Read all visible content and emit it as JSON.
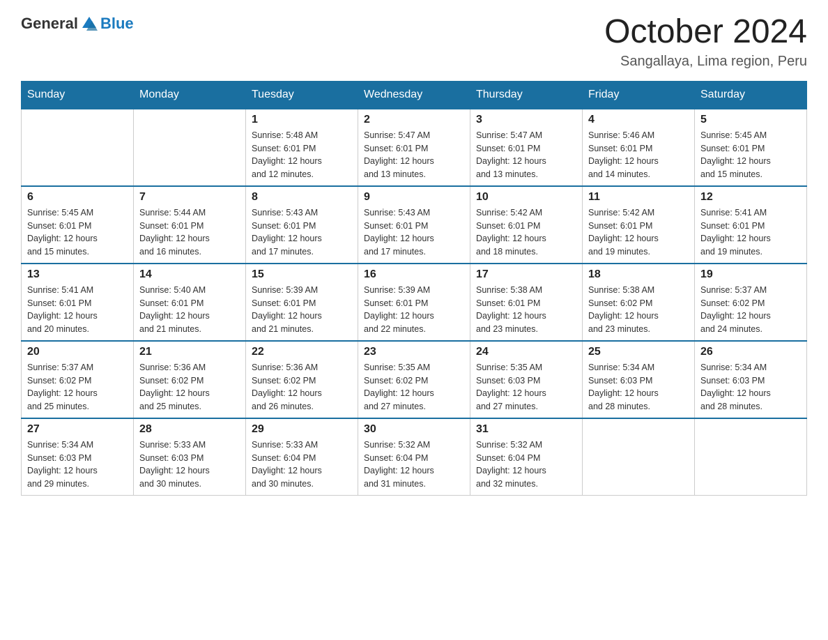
{
  "logo": {
    "general": "General",
    "blue": "Blue"
  },
  "title": "October 2024",
  "subtitle": "Sangallaya, Lima region, Peru",
  "days_of_week": [
    "Sunday",
    "Monday",
    "Tuesday",
    "Wednesday",
    "Thursday",
    "Friday",
    "Saturday"
  ],
  "weeks": [
    [
      {
        "day": "",
        "info": ""
      },
      {
        "day": "",
        "info": ""
      },
      {
        "day": "1",
        "info": "Sunrise: 5:48 AM\nSunset: 6:01 PM\nDaylight: 12 hours\nand 12 minutes."
      },
      {
        "day": "2",
        "info": "Sunrise: 5:47 AM\nSunset: 6:01 PM\nDaylight: 12 hours\nand 13 minutes."
      },
      {
        "day": "3",
        "info": "Sunrise: 5:47 AM\nSunset: 6:01 PM\nDaylight: 12 hours\nand 13 minutes."
      },
      {
        "day": "4",
        "info": "Sunrise: 5:46 AM\nSunset: 6:01 PM\nDaylight: 12 hours\nand 14 minutes."
      },
      {
        "day": "5",
        "info": "Sunrise: 5:45 AM\nSunset: 6:01 PM\nDaylight: 12 hours\nand 15 minutes."
      }
    ],
    [
      {
        "day": "6",
        "info": "Sunrise: 5:45 AM\nSunset: 6:01 PM\nDaylight: 12 hours\nand 15 minutes."
      },
      {
        "day": "7",
        "info": "Sunrise: 5:44 AM\nSunset: 6:01 PM\nDaylight: 12 hours\nand 16 minutes."
      },
      {
        "day": "8",
        "info": "Sunrise: 5:43 AM\nSunset: 6:01 PM\nDaylight: 12 hours\nand 17 minutes."
      },
      {
        "day": "9",
        "info": "Sunrise: 5:43 AM\nSunset: 6:01 PM\nDaylight: 12 hours\nand 17 minutes."
      },
      {
        "day": "10",
        "info": "Sunrise: 5:42 AM\nSunset: 6:01 PM\nDaylight: 12 hours\nand 18 minutes."
      },
      {
        "day": "11",
        "info": "Sunrise: 5:42 AM\nSunset: 6:01 PM\nDaylight: 12 hours\nand 19 minutes."
      },
      {
        "day": "12",
        "info": "Sunrise: 5:41 AM\nSunset: 6:01 PM\nDaylight: 12 hours\nand 19 minutes."
      }
    ],
    [
      {
        "day": "13",
        "info": "Sunrise: 5:41 AM\nSunset: 6:01 PM\nDaylight: 12 hours\nand 20 minutes."
      },
      {
        "day": "14",
        "info": "Sunrise: 5:40 AM\nSunset: 6:01 PM\nDaylight: 12 hours\nand 21 minutes."
      },
      {
        "day": "15",
        "info": "Sunrise: 5:39 AM\nSunset: 6:01 PM\nDaylight: 12 hours\nand 21 minutes."
      },
      {
        "day": "16",
        "info": "Sunrise: 5:39 AM\nSunset: 6:01 PM\nDaylight: 12 hours\nand 22 minutes."
      },
      {
        "day": "17",
        "info": "Sunrise: 5:38 AM\nSunset: 6:01 PM\nDaylight: 12 hours\nand 23 minutes."
      },
      {
        "day": "18",
        "info": "Sunrise: 5:38 AM\nSunset: 6:02 PM\nDaylight: 12 hours\nand 23 minutes."
      },
      {
        "day": "19",
        "info": "Sunrise: 5:37 AM\nSunset: 6:02 PM\nDaylight: 12 hours\nand 24 minutes."
      }
    ],
    [
      {
        "day": "20",
        "info": "Sunrise: 5:37 AM\nSunset: 6:02 PM\nDaylight: 12 hours\nand 25 minutes."
      },
      {
        "day": "21",
        "info": "Sunrise: 5:36 AM\nSunset: 6:02 PM\nDaylight: 12 hours\nand 25 minutes."
      },
      {
        "day": "22",
        "info": "Sunrise: 5:36 AM\nSunset: 6:02 PM\nDaylight: 12 hours\nand 26 minutes."
      },
      {
        "day": "23",
        "info": "Sunrise: 5:35 AM\nSunset: 6:02 PM\nDaylight: 12 hours\nand 27 minutes."
      },
      {
        "day": "24",
        "info": "Sunrise: 5:35 AM\nSunset: 6:03 PM\nDaylight: 12 hours\nand 27 minutes."
      },
      {
        "day": "25",
        "info": "Sunrise: 5:34 AM\nSunset: 6:03 PM\nDaylight: 12 hours\nand 28 minutes."
      },
      {
        "day": "26",
        "info": "Sunrise: 5:34 AM\nSunset: 6:03 PM\nDaylight: 12 hours\nand 28 minutes."
      }
    ],
    [
      {
        "day": "27",
        "info": "Sunrise: 5:34 AM\nSunset: 6:03 PM\nDaylight: 12 hours\nand 29 minutes."
      },
      {
        "day": "28",
        "info": "Sunrise: 5:33 AM\nSunset: 6:03 PM\nDaylight: 12 hours\nand 30 minutes."
      },
      {
        "day": "29",
        "info": "Sunrise: 5:33 AM\nSunset: 6:04 PM\nDaylight: 12 hours\nand 30 minutes."
      },
      {
        "day": "30",
        "info": "Sunrise: 5:32 AM\nSunset: 6:04 PM\nDaylight: 12 hours\nand 31 minutes."
      },
      {
        "day": "31",
        "info": "Sunrise: 5:32 AM\nSunset: 6:04 PM\nDaylight: 12 hours\nand 32 minutes."
      },
      {
        "day": "",
        "info": ""
      },
      {
        "day": "",
        "info": ""
      }
    ]
  ]
}
